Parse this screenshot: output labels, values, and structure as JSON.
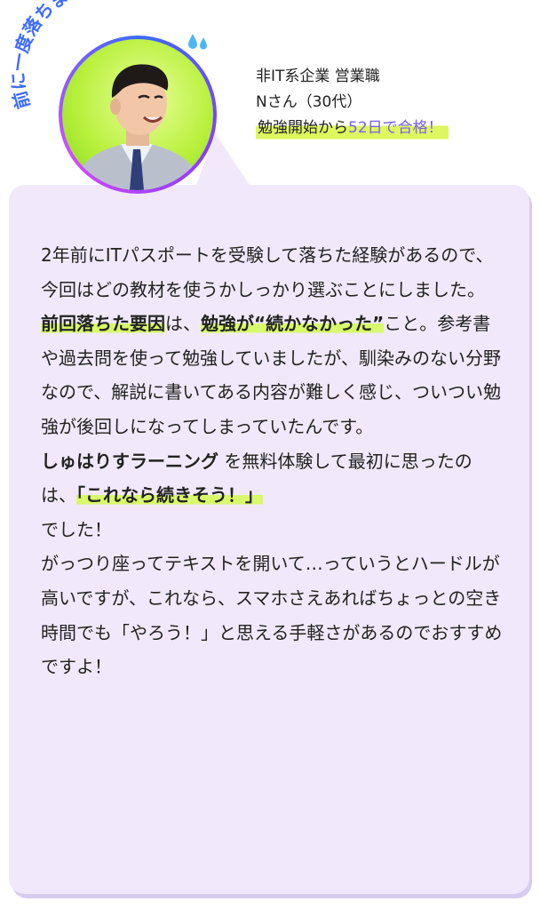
{
  "badge": {
    "label": "前に一度落ちました",
    "drops_icon": "sweat-drops-icon"
  },
  "profile": {
    "company": "非IT系企業 営業職",
    "name": "Nさん（30代）",
    "result_prefix": "勉強開始から",
    "result_highlight": "52日で合格！"
  },
  "story": {
    "p1": "2年前にITパスポートを受験して落ちた経験があるので、今回はどの教材を使うかしっかり選ぶことにしました。",
    "p2_bold1": "前回落ちた要因",
    "p2_mid": "は、",
    "p2_bold2": "勉強が“続かなかった”",
    "p2_rest": "こと。参考書や過去問を使って勉強していましたが、馴染みのない分野なので、解説に書いてある内容が難しく感じ、ついつい勉強が後回しになってしまっていたんです。",
    "p3_bold": "しゅはりすラーニング",
    "p3_mid": " を無料体験して最初に思ったのは、",
    "p3_quote": "「これなら続きそう！」",
    "p3_rest": "でした！",
    "p4": "がっつり座ってテキストを開いて…っていうとハードルが高いですが、これなら、スマホさえあればちょっとの空き時間でも「やろう！」と思える手軽さがあるのでおすすめですよ！"
  },
  "colors": {
    "card_bg": "#f1e9fb",
    "highlight": "#d9f86a",
    "accent": "#7a5cf0",
    "ring": "#8a3bff"
  }
}
